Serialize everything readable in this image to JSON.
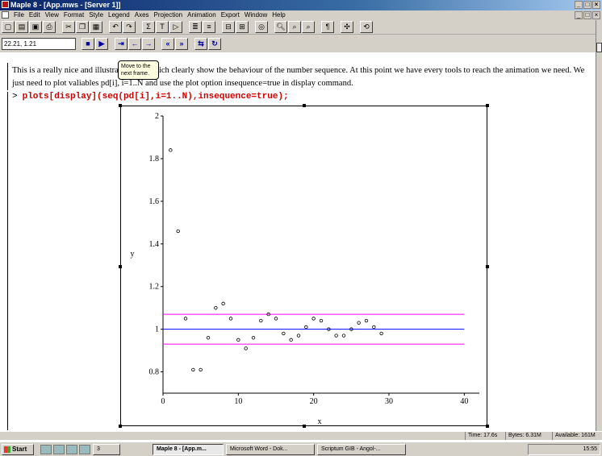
{
  "window": {
    "title": "Maple 8 - [App.mws - [Server 1]]"
  },
  "menu": {
    "items": [
      "File",
      "Edit",
      "View",
      "Format",
      "Style",
      "Legend",
      "Axes",
      "Projection",
      "Animation",
      "Export",
      "Window",
      "Help"
    ]
  },
  "toolbar": {
    "coord_value": "22.21, 1.21",
    "tooltip": "Move to the next frame."
  },
  "document": {
    "paragraph": "This is a really nice and illustrative plot which clearly show the behaviour of the number sequence. At this point we have every tools to reach the animation we need. We just need to plot valiables pd[i], i=1..N and use the plot option insequence=true in display command.",
    "command": "plots[display](seq(pd[i],i=1..N),insequence=true);",
    "prompt_symbol": ">"
  },
  "chart_data": {
    "type": "scatter",
    "xlabel": "x",
    "ylabel": "y",
    "xlim": [
      0,
      42
    ],
    "ylim": [
      0.7,
      2.0
    ],
    "x_ticks": [
      0,
      10,
      20,
      30,
      40
    ],
    "y_ticks": [
      0.8,
      1,
      1.2,
      1.4,
      1.6,
      1.8,
      2
    ],
    "points": [
      [
        1,
        1.84
      ],
      [
        2,
        1.46
      ],
      [
        3,
        1.05
      ],
      [
        4,
        0.81
      ],
      [
        5,
        0.81
      ],
      [
        6,
        0.96
      ],
      [
        7,
        1.1
      ],
      [
        8,
        1.12
      ],
      [
        9,
        1.05
      ],
      [
        10,
        0.95
      ],
      [
        11,
        0.91
      ],
      [
        12,
        0.96
      ],
      [
        13,
        1.04
      ],
      [
        14,
        1.07
      ],
      [
        15,
        1.05
      ],
      [
        16,
        0.98
      ],
      [
        17,
        0.95
      ],
      [
        18,
        0.97
      ],
      [
        19,
        1.01
      ],
      [
        20,
        1.05
      ],
      [
        21,
        1.04
      ],
      [
        22,
        1.0
      ],
      [
        23,
        0.97
      ],
      [
        24,
        0.97
      ],
      [
        25,
        1.0
      ],
      [
        26,
        1.03
      ],
      [
        27,
        1.04
      ],
      [
        28,
        1.01
      ],
      [
        29,
        0.98
      ]
    ],
    "hlines": [
      {
        "y": 1.07,
        "color": "#ff00ff"
      },
      {
        "y": 1.0,
        "color": "#0000ff"
      },
      {
        "y": 0.93,
        "color": "#ff00ff"
      }
    ],
    "hline_x_range": [
      0,
      40
    ]
  },
  "status": {
    "time": "Time: 17.6s",
    "bytes": "Bytes: 6.31M",
    "available": "Available: 161M"
  },
  "taskbar": {
    "start_label": "Start",
    "group_label": "3",
    "tasks": [
      "Maple 8 - [App.m...",
      "Microsoft Word - Dok...",
      "Scriptum GIB - Angol-..."
    ],
    "clock": "15:55"
  }
}
